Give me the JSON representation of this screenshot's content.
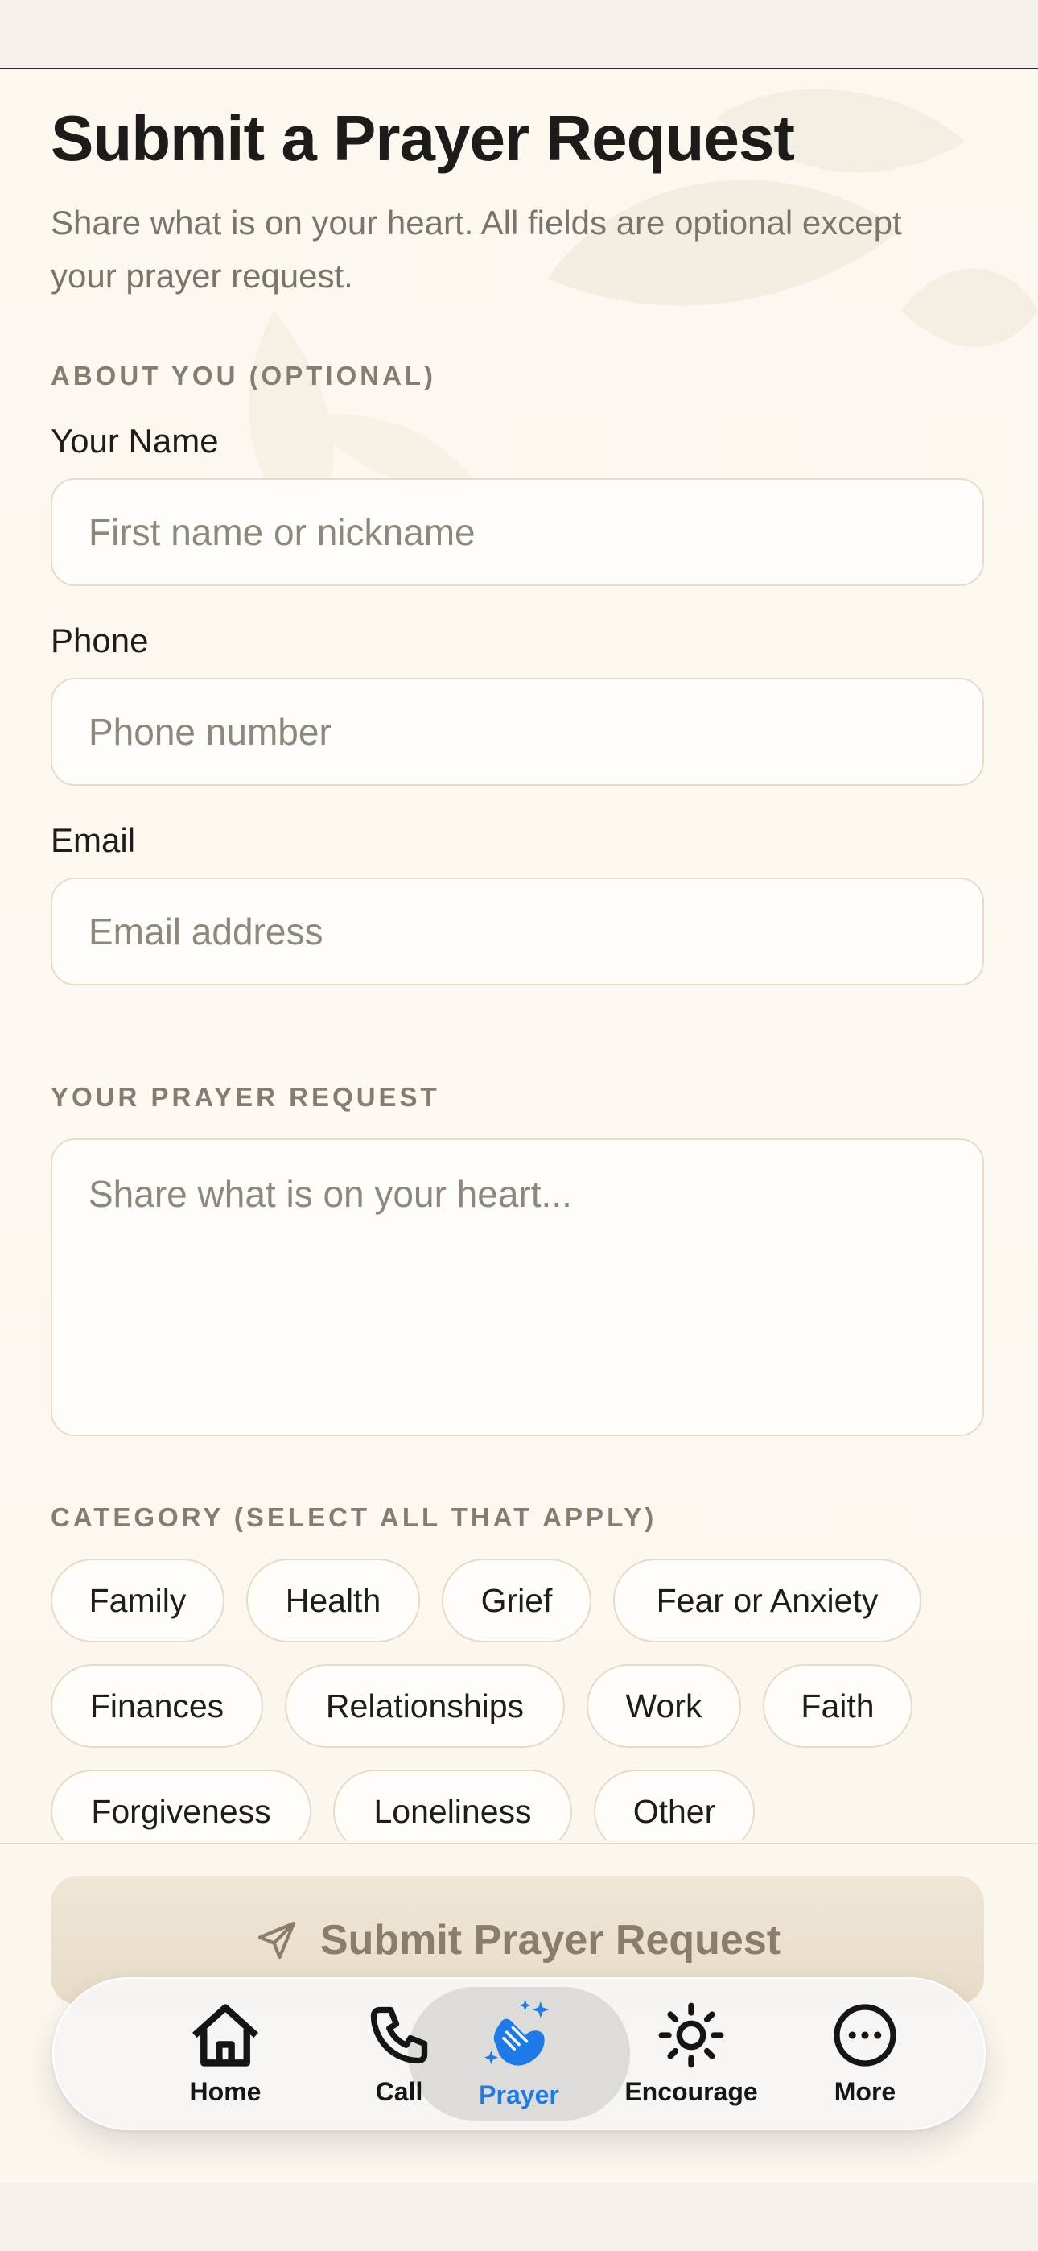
{
  "page": {
    "title": "Submit a Prayer Request",
    "subtitle": "Share what is on your heart. All fields are optional except your prayer request."
  },
  "about": {
    "section_label": "ABOUT YOU (OPTIONAL)",
    "name": {
      "label": "Your Name",
      "placeholder": "First name or nickname"
    },
    "phone": {
      "label": "Phone",
      "placeholder": "Phone number"
    },
    "email": {
      "label": "Email",
      "placeholder": "Email address"
    }
  },
  "request": {
    "section_label": "YOUR PRAYER REQUEST",
    "placeholder": "Share what is on your heart..."
  },
  "category": {
    "section_label": "CATEGORY (SELECT ALL THAT APPLY)",
    "chips": [
      "Family",
      "Health",
      "Grief",
      "Fear or Anxiety",
      "Finances",
      "Relationships",
      "Work",
      "Faith",
      "Forgiveness",
      "Loneliness",
      "Other"
    ]
  },
  "submit": {
    "label": "Submit Prayer Request",
    "icon": "send-icon"
  },
  "tabbar": {
    "items": [
      {
        "label": "Home",
        "icon": "home-icon",
        "active": false
      },
      {
        "label": "Call",
        "icon": "phone-icon",
        "active": false
      },
      {
        "label": "Prayer",
        "icon": "praying-hands-icon",
        "active": true
      },
      {
        "label": "Encourage",
        "icon": "sun-icon",
        "active": false
      },
      {
        "label": "More",
        "icon": "more-icon",
        "active": false
      }
    ]
  },
  "colors": {
    "accent": "#1e7ae6",
    "background": "#fbf6ee",
    "border": "#e8dcc9"
  }
}
